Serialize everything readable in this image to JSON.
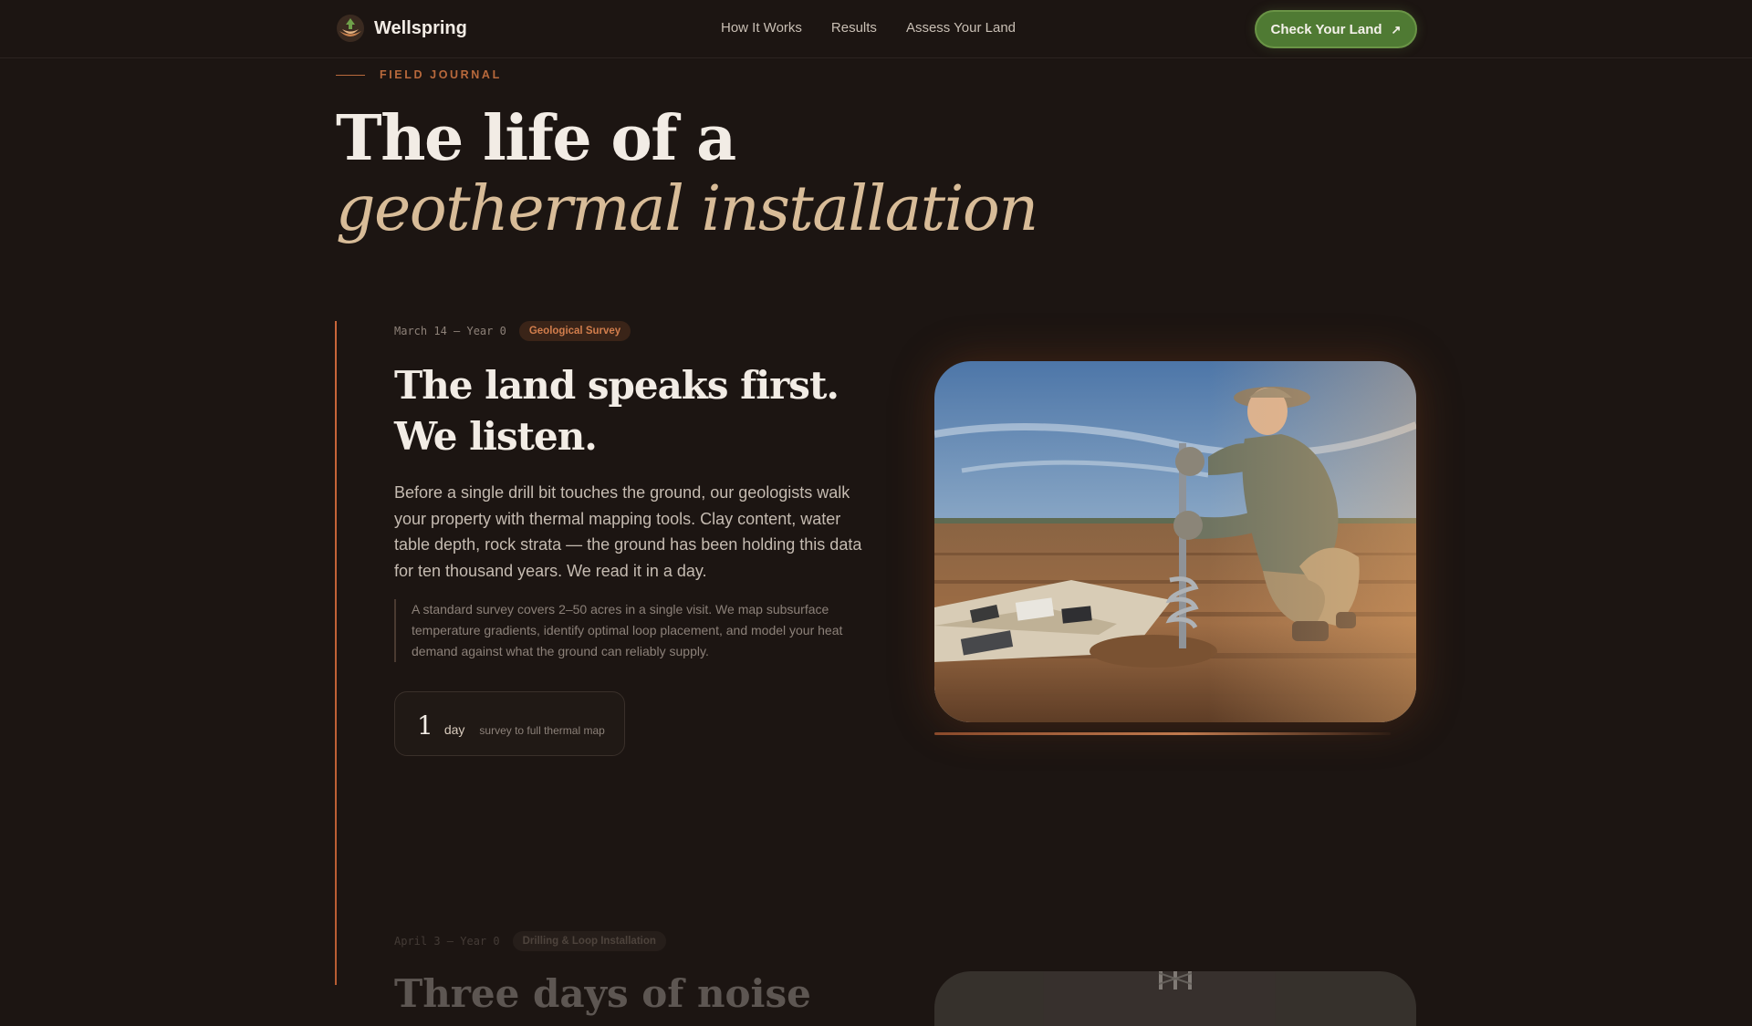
{
  "nav": {
    "brand": "Wellspring",
    "links": [
      "How It Works",
      "Results",
      "Assess Your Land"
    ],
    "cta": "Check Your Land",
    "cta_icon": "arrow-up-right-icon"
  },
  "header": {
    "eyebrow": "FIELD JOURNAL",
    "title_line1": "The life of a",
    "title_line2": "geothermal installation"
  },
  "entries": [
    {
      "date": "March 14 — Year 0",
      "tag": "Geological Survey",
      "title": "The land speaks first. We listen.",
      "body": "Before a single drill bit touches the ground, our geologists walk your property with thermal mapping tools. Clay content, water table depth, rock strata — the ground has been holding this data for ten thousand years. We read it in a day.",
      "quote": "A standard survey covers 2–50 acres in a single visit. We map subsurface temperature gradients, identify optimal loop placement, and model your heat demand against what the ground can reliably supply.",
      "stat": {
        "number": "1",
        "unit": "day",
        "desc": "survey to full thermal map"
      }
    },
    {
      "date": "April 3 — Year 0",
      "tag": "Drilling & Loop Installation",
      "title": "Three days of noise"
    }
  ],
  "colors": {
    "background": "#1c1512",
    "accent": "#c9663a",
    "cta": "#4f7a33",
    "title_italic": "#d8bc98"
  }
}
